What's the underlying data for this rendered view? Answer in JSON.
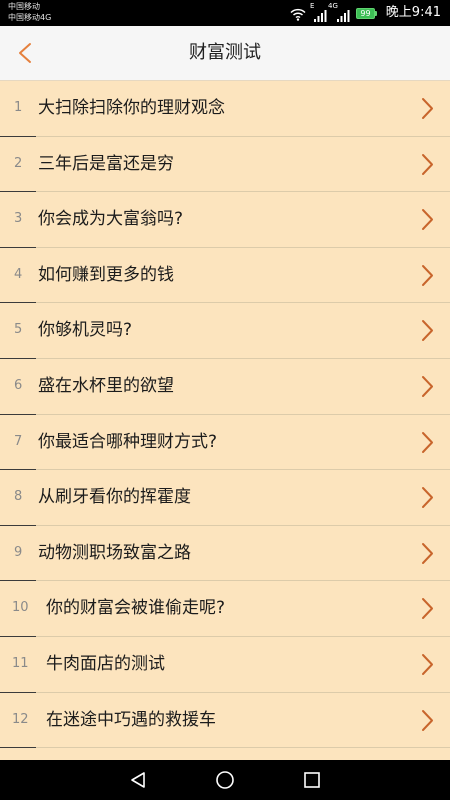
{
  "status_bar": {
    "carrier_primary": "中国移动",
    "carrier_secondary": "中国移动4G",
    "signal_1_type": "E",
    "signal_2_type": "4G",
    "battery_level": "99",
    "time": "晚上9:41",
    "icons": [
      "wifi-icon",
      "signal-icon",
      "signal-icon",
      "battery-icon"
    ]
  },
  "header": {
    "title": "财富测试",
    "back_icon": "chevron-left-icon"
  },
  "list": {
    "item_icon": "chevron-right-icon",
    "items": [
      {
        "number": "1",
        "title": "大扫除扫除你的理财观念"
      },
      {
        "number": "2",
        "title": "三年后是富还是穷"
      },
      {
        "number": "3",
        "title": "你会成为大富翁吗?"
      },
      {
        "number": "4",
        "title": "如何赚到更多的钱"
      },
      {
        "number": "5",
        "title": "你够机灵吗?"
      },
      {
        "number": "6",
        "title": "盛在水杯里的欲望"
      },
      {
        "number": "7",
        "title": "你最适合哪种理财方式?"
      },
      {
        "number": "8",
        "title": "从刷牙看你的挥霍度"
      },
      {
        "number": "9",
        "title": "动物测职场致富之路"
      },
      {
        "number": "10",
        "title": "你的财富会被谁偷走呢?"
      },
      {
        "number": "11",
        "title": "牛肉面店的测试"
      },
      {
        "number": "12",
        "title": "在迷途中巧遇的救援车"
      }
    ]
  },
  "nav_bar": {
    "icons": [
      "back-triangle-icon",
      "home-circle-icon",
      "recents-square-icon"
    ]
  },
  "colors": {
    "status_bar_bg": "#000000",
    "header_bg": "#F6F6F6",
    "list_bg": "#FCE4BE",
    "back_accent": "#E5803D",
    "chevron": "#C8652C",
    "number_text": "#8A8A8A",
    "title_text": "#1C1C1C",
    "divider_dark": "#3B3B3B",
    "divider_light": "#DCCBAA",
    "battery": "#3DBE55"
  }
}
